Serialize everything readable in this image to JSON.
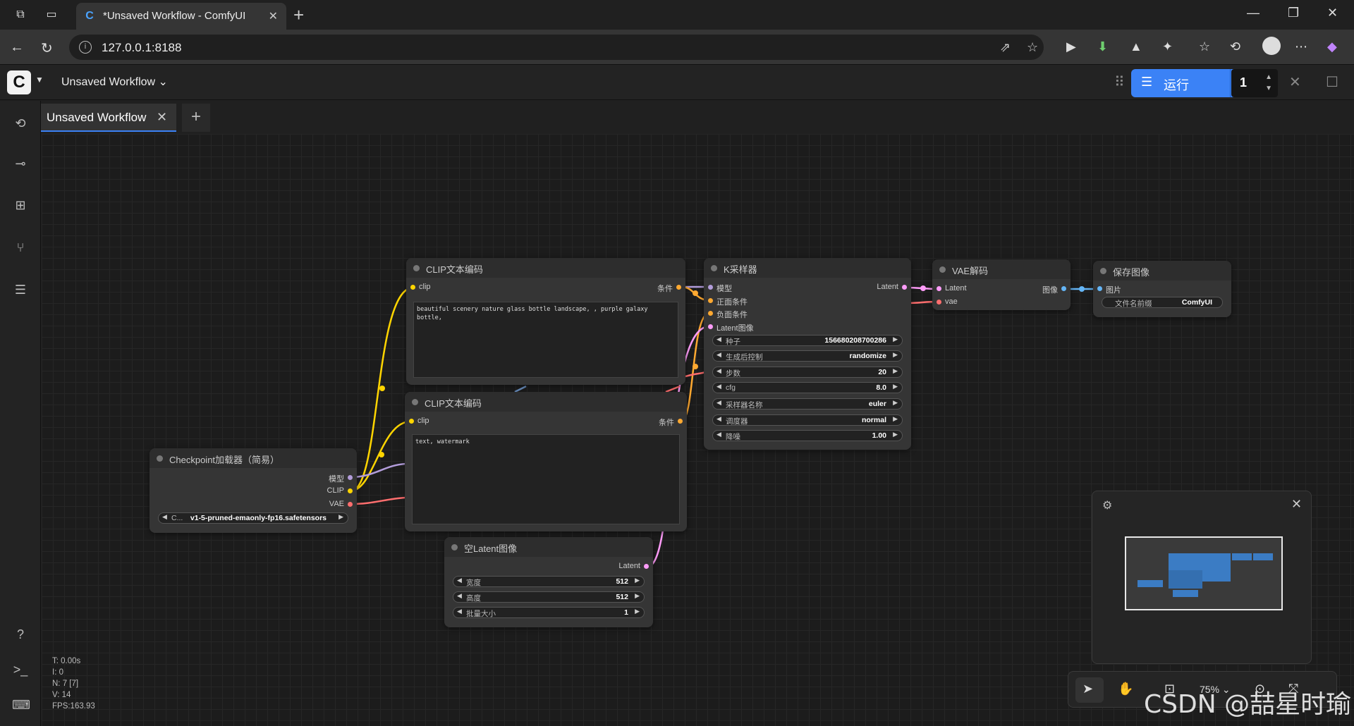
{
  "browser": {
    "tab_title": "*Unsaved Workflow - ComfyUI",
    "url": "127.0.0.1:8188"
  },
  "app": {
    "workflow_menu": "Unsaved Workflow",
    "run_label": "运行",
    "batch_count": "1",
    "workflow_tab": "Unsaved Workflow"
  },
  "nodes": {
    "clip1": {
      "title": "CLIP文本编码",
      "in_clip": "clip",
      "out_cond": "条件",
      "text": "beautiful scenery nature glass bottle landscape, , purple galaxy bottle,"
    },
    "clip2": {
      "title": "CLIP文本编码",
      "in_clip": "clip",
      "out_cond": "条件",
      "text": "text, watermark"
    },
    "ksampler": {
      "title": "K采样器",
      "in_model": "模型",
      "in_pos": "正面条件",
      "in_neg": "负面条件",
      "in_latent": "Latent图像",
      "out_latent": "Latent",
      "widgets": [
        {
          "label": "种子",
          "value": "156680208700286"
        },
        {
          "label": "生成后控制",
          "value": "randomize"
        },
        {
          "label": "步数",
          "value": "20"
        },
        {
          "label": "cfg",
          "value": "8.0"
        },
        {
          "label": "采样器名称",
          "value": "euler"
        },
        {
          "label": "调度器",
          "value": "normal"
        },
        {
          "label": "降噪",
          "value": "1.00"
        }
      ]
    },
    "vae": {
      "title": "VAE解码",
      "in_latent": "Latent",
      "in_vae": "vae",
      "out_image": "图像"
    },
    "save": {
      "title": "保存图像",
      "in_image": "图片",
      "prefix_label": "文件名前缀",
      "prefix_value": "ComfyUI"
    },
    "ckpt": {
      "title": "Checkpoint加载器（简易）",
      "out_model": "模型",
      "out_clip": "CLIP",
      "out_vae": "VAE",
      "widget_label": "C...",
      "widget_value": "v1-5-pruned-emaonly-fp16.safetensors"
    },
    "latent": {
      "title": "空Latent图像",
      "out_latent": "Latent",
      "widgets": [
        {
          "label": "宽度",
          "value": "512"
        },
        {
          "label": "高度",
          "value": "512"
        },
        {
          "label": "批量大小",
          "value": "1"
        }
      ]
    }
  },
  "stats": [
    "T: 0.00s",
    "I: 0",
    "N: 7 [7]",
    "V: 14",
    "FPS:163.93"
  ],
  "zoom": "75%",
  "watermark": "CSDN @喆星时瑜",
  "colors": {
    "accent": "#3b82f6",
    "clip": "#ffd500",
    "conditioning": "#ffa931",
    "model": "#b39ddb",
    "vae": "#ff6e6e",
    "latent": "#ff9cf9",
    "image": "#64b5f6"
  }
}
